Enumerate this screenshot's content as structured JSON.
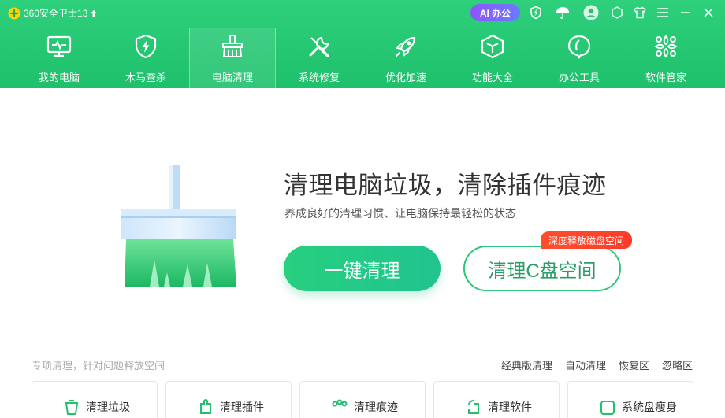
{
  "titlebar": {
    "app_name": "360安全卫士13",
    "ai_button": "AI 办公",
    "icons": [
      "upgrade-arrow-icon",
      "shield-bolt-icon",
      "umbrella-icon",
      "user-avatar-icon",
      "skin-icon",
      "shirt-icon",
      "menu-icon",
      "minimize-icon",
      "close-icon"
    ]
  },
  "nav": {
    "items": [
      {
        "label": "我的电脑",
        "icon": "monitor-icon"
      },
      {
        "label": "木马查杀",
        "icon": "shield-bolt-icon"
      },
      {
        "label": "电脑清理",
        "icon": "broom-icon",
        "active": true
      },
      {
        "label": "系统修复",
        "icon": "wrench-screwdriver-icon"
      },
      {
        "label": "优化加速",
        "icon": "rocket-icon"
      },
      {
        "label": "功能大全",
        "icon": "cube-icon"
      },
      {
        "label": "办公工具",
        "icon": "office-icon"
      },
      {
        "label": "软件管家",
        "icon": "apps-icon"
      }
    ]
  },
  "hero": {
    "title": "清理电脑垃圾，清除插件痕迹",
    "subtitle": "养成良好的清理习惯、让电脑保持最轻松的状态",
    "primary_button": "一键清理",
    "secondary_button": "清理C盘空间",
    "badge": "深度释放磁盘空间"
  },
  "section": {
    "title": "专项清理，针对问题释放空间",
    "links": [
      "经典版清理",
      "自动清理",
      "恢复区",
      "忽略区"
    ]
  },
  "cards": [
    {
      "label": "清理垃圾",
      "icon": "trash-clean-icon"
    },
    {
      "label": "清理插件",
      "icon": "plugin-icon"
    },
    {
      "label": "清理痕迹",
      "icon": "trace-icon"
    },
    {
      "label": "清理软件",
      "icon": "software-icon"
    },
    {
      "label": "系统盘瘦身",
      "icon": "disk-icon"
    }
  ],
  "colors": {
    "header_green": "#1ec06c",
    "accent_green": "#26d07f",
    "badge_red": "#ff3b2a",
    "ai_purple": "#8e55ff"
  }
}
